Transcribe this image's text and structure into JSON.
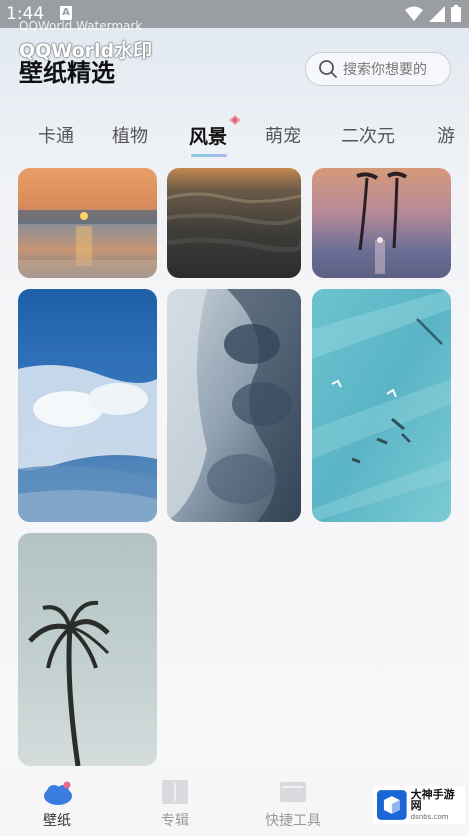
{
  "status_bar": {
    "time": "1:44",
    "notification_letter": "A"
  },
  "watermark": {
    "small": "QQWorld Watermark",
    "big": "QQWorld水印"
  },
  "header": {
    "title": "壁纸精选"
  },
  "search": {
    "placeholder": "搜索你想要的"
  },
  "tabs": [
    {
      "label": "卡通",
      "active": false
    },
    {
      "label": "植物",
      "active": false
    },
    {
      "label": "风景",
      "active": true
    },
    {
      "label": "萌宠",
      "active": false
    },
    {
      "label": "二次元",
      "active": false
    },
    {
      "label": "游",
      "active": false
    }
  ],
  "wallpapers": [
    {
      "name": "sunset-sea"
    },
    {
      "name": "dark-waves"
    },
    {
      "name": "palm-dusk"
    },
    {
      "name": "ocean-foam"
    },
    {
      "name": "misty-waves"
    },
    {
      "name": "turquoise-water-birds"
    },
    {
      "name": "palm-tree-sky"
    }
  ],
  "bottom_nav": {
    "items": [
      {
        "label": "壁纸",
        "active": true
      },
      {
        "label": "专辑",
        "active": false
      },
      {
        "label": "快捷工具",
        "active": false
      }
    ]
  },
  "brand": {
    "name": "大神手游网",
    "url": "dsnbs.com"
  },
  "colors": {
    "accent": "#3a7de0",
    "tab_underline_start": "#7fd1d8",
    "tab_underline_end": "#a9b8f0"
  }
}
